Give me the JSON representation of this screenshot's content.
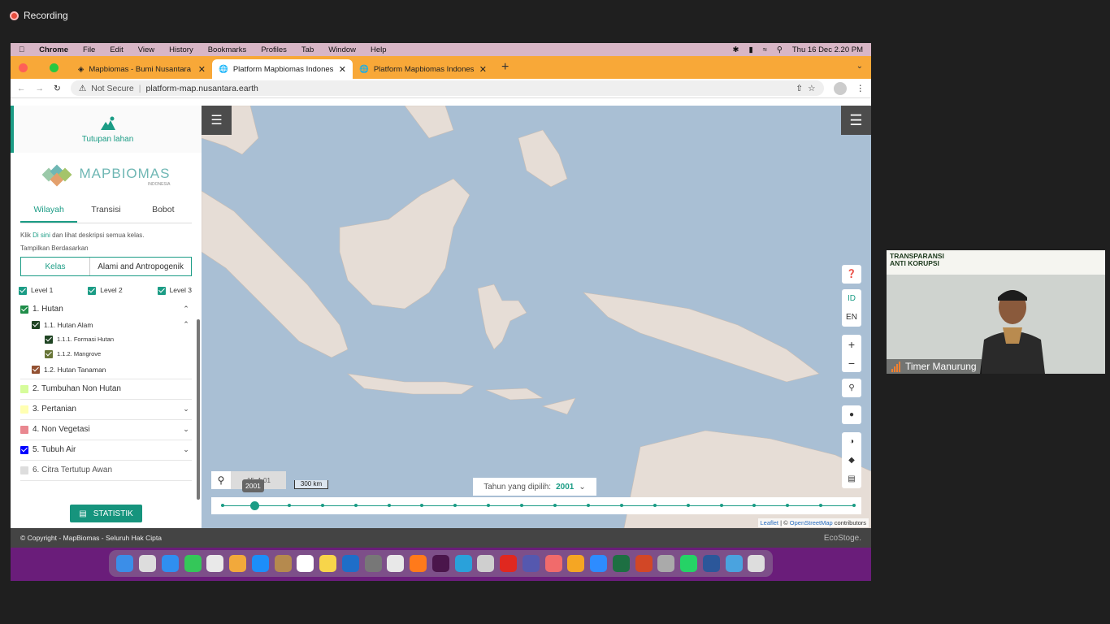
{
  "recording": {
    "label": "Recording"
  },
  "menubar": {
    "app": "Chrome",
    "items": [
      "File",
      "Edit",
      "View",
      "History",
      "Bookmarks",
      "Profiles",
      "Tab",
      "Window",
      "Help"
    ],
    "clock": "Thu 16 Dec  2.20 PM"
  },
  "browser": {
    "tabs": [
      {
        "title": "Mapbiomas - Bumi Nusantara",
        "active": false
      },
      {
        "title": "Platform Mapbiomas Indonesia",
        "active": true
      },
      {
        "title": "Platform Mapbiomas Indonesia",
        "active": false
      }
    ],
    "security": "Not Secure",
    "url": "platform-map.nusantara.earth"
  },
  "sidebar": {
    "section_label": "Tutupan lahan",
    "logo_text": "MAPBIOMAS",
    "logo_sub": "INDONESIA",
    "tabs": [
      "Wilayah",
      "Transisi",
      "Bobot"
    ],
    "hint_prefix": "Klik ",
    "hint_link": "Di sini",
    "hint_suffix": " dan lihat deskripsi semua kelas.",
    "show_by": "Tampilkan Berdasarkan",
    "segment": [
      "Kelas",
      "Alami and Antropogenik"
    ],
    "levels": [
      "Level 1",
      "Level 2",
      "Level 3"
    ],
    "classes": {
      "hutan": "1. Hutan",
      "hutan_alam": "1.1. Hutan Alam",
      "formasi_hutan": "1.1.1. Formasi Hutan",
      "mangrove": "1.1.2. Mangrove",
      "hutan_tanaman": "1.2. Hutan Tanaman",
      "tumbuhan_non_hutan": "2. Tumbuhan Non Hutan",
      "pertanian": "3. Pertanian",
      "non_vegetasi": "4. Non Vegetasi",
      "tubuh_air": "5. Tubuh Air",
      "citra_awan": "6. Citra Tertutup Awan"
    },
    "stat_button": "STATISTIK"
  },
  "map": {
    "search_text": "15, 1 01",
    "scale": "300 km",
    "year_label": "Tahun yang dipilih:",
    "year_value": "2001",
    "tooltip_year": "2001",
    "lang_id": "ID",
    "lang_en": "EN",
    "attribution_leaflet": "Leaflet",
    "attribution_sep": " | © ",
    "attribution_osm": "OpenStreetMap",
    "attribution_suffix": " contributors"
  },
  "footer": {
    "copyright": "© Copyright - MapBiomas - Seluruh Hak Cipta",
    "brand": "EcoStoge."
  },
  "video": {
    "banner_title_1": "TRANSPARANSI",
    "banner_title_2": "ANTI KORUPSI",
    "participant": "Timer Manurung"
  },
  "colors": {
    "accent": "#1b9c85",
    "hutan": "#1f8d49",
    "hutan_alam": "#1f4423",
    "formasi_hutan": "#1f4423",
    "mangrove": "#687537",
    "hutan_tanaman": "#935132",
    "tumbuhan_non_hutan": "#d6fc9b",
    "pertanian": "#ffffb2",
    "non_vegetasi": "#e98790",
    "tubuh_air": "#0000ff",
    "citra_awan": "#dddddd"
  }
}
